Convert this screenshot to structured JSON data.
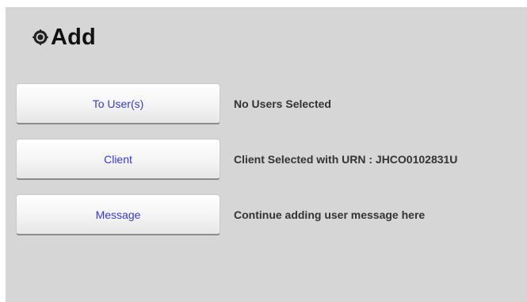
{
  "panel": {
    "title": "Add",
    "title_icon": "gear-icon"
  },
  "rows": [
    {
      "button_label": "To User(s)",
      "status": "No Users Selected"
    },
    {
      "button_label": "Client",
      "status": "Client Selected with URN : JHCO0102831U"
    },
    {
      "button_label": "Message",
      "status": "Continue adding user message here"
    }
  ],
  "colors": {
    "panel_bg": "#d6d6d6",
    "button_text": "#3a3acc",
    "status_text": "#333333"
  }
}
